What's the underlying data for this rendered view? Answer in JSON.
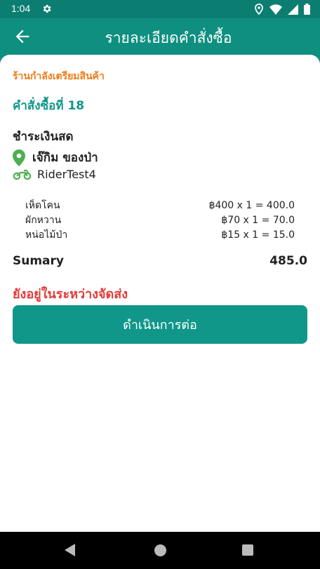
{
  "status_bar": {
    "time": "1:04"
  },
  "header": {
    "title": "รายละเอียดคำสั่งซื้อ"
  },
  "order": {
    "status_text": "ร้านกำลังเตรียมสินค้า",
    "order_label": "คำสั่งซื้อที่ 18",
    "payment_method": "ชำระเงินสด",
    "shop_name": "เจ๊กิม ของป่า",
    "rider_name": "RiderTest4",
    "items": [
      {
        "name": "เห็ดโคน",
        "price": "฿400 x 1 = 400.0"
      },
      {
        "name": "ผักหวาน",
        "price": "฿70 x 1 = 70.0"
      },
      {
        "name": "หน่อไม้ป่า",
        "price": "฿15 x 1 = 15.0"
      }
    ],
    "summary_label": "Sumary",
    "summary_value": "485.0",
    "delivery_status": "ยังอยู่ในระหว่างจัดส่ง",
    "continue_button": "ดำเนินการต่อ"
  },
  "colors": {
    "primary": "#0e8f80",
    "status_orange": "#f07b14",
    "alert_red": "#e53b3b",
    "pin_green": "#4caf50"
  }
}
